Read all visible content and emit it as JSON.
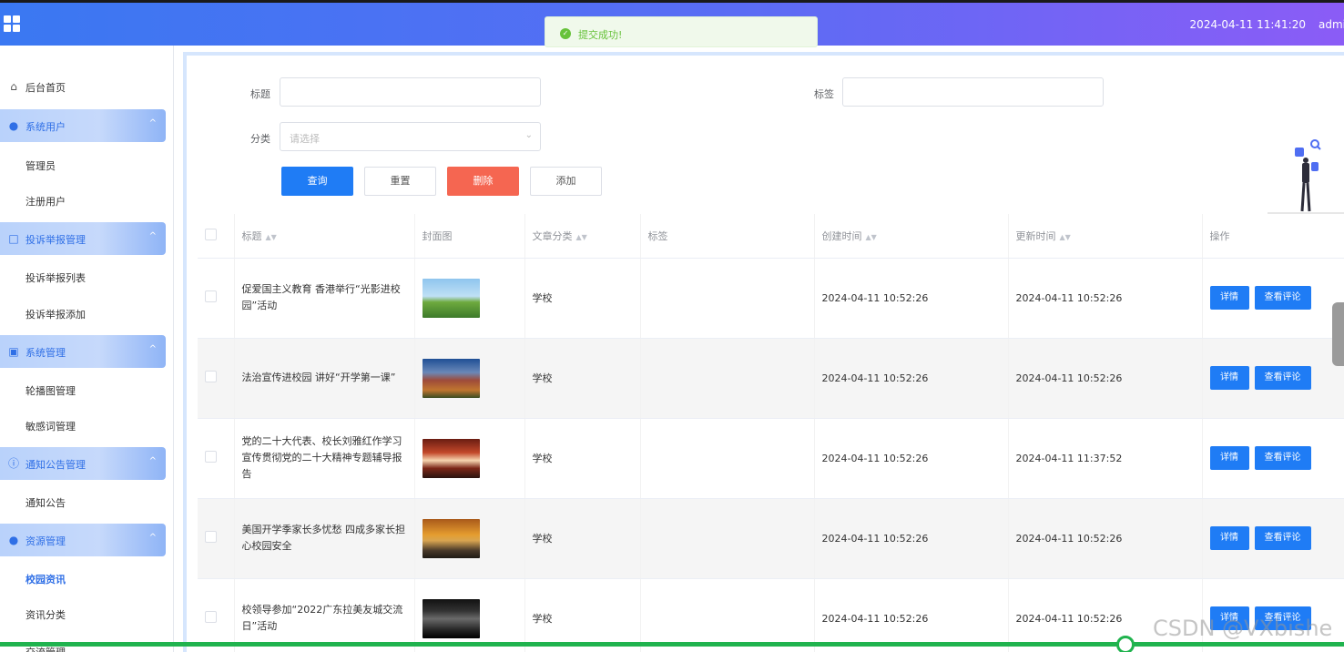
{
  "topbar": {
    "datetime": "2024-04-11 11:41:20",
    "user": "admi"
  },
  "toast": {
    "message": "提交成功!"
  },
  "sidebar": {
    "items": [
      {
        "label": "后台首页",
        "icon": "home-icon",
        "type": "item"
      },
      {
        "label": "系统用户",
        "icon": "user-icon",
        "type": "group"
      },
      {
        "label": "管理员",
        "type": "sub"
      },
      {
        "label": "注册用户",
        "type": "sub"
      },
      {
        "label": "投诉举报管理",
        "icon": "report-icon",
        "type": "group"
      },
      {
        "label": "投诉举报列表",
        "type": "sub"
      },
      {
        "label": "投诉举报添加",
        "type": "sub"
      },
      {
        "label": "系统管理",
        "icon": "picture-icon",
        "type": "group"
      },
      {
        "label": "轮播图管理",
        "type": "sub"
      },
      {
        "label": "敏感词管理",
        "type": "sub"
      },
      {
        "label": "通知公告管理",
        "icon": "info-icon",
        "type": "group"
      },
      {
        "label": "通知公告",
        "type": "sub"
      },
      {
        "label": "资源管理",
        "icon": "location-icon",
        "type": "group"
      },
      {
        "label": "校园资讯",
        "type": "sub",
        "active": true
      },
      {
        "label": "资讯分类",
        "type": "sub"
      },
      {
        "label": "交流管理",
        "type": "group-cut"
      }
    ]
  },
  "filters": {
    "title_label": "标题",
    "tag_label": "标签",
    "category_label": "分类",
    "category_placeholder": "请选择",
    "title_value": "",
    "tag_value": ""
  },
  "actions": {
    "search": "查询",
    "reset": "重置",
    "delete": "删除",
    "add": "添加"
  },
  "table": {
    "headers": [
      "标题",
      "封面图",
      "文章分类",
      "标签",
      "创建时间",
      "更新时间",
      "操作"
    ],
    "rows": [
      {
        "title": "促爱国主义教育 香港举行“光影进校园”活动",
        "category": "学校",
        "tag": "",
        "created": "2024-04-11 10:52:26",
        "updated": "2024-04-11 10:52:26"
      },
      {
        "title": "法治宣传进校园 讲好“开学第一课”",
        "category": "学校",
        "tag": "",
        "created": "2024-04-11 10:52:26",
        "updated": "2024-04-11 10:52:26"
      },
      {
        "title": "党的二十大代表、校长刘雅红作学习宣传贯彻党的二十大精神专题辅导报告",
        "category": "学校",
        "tag": "",
        "created": "2024-04-11 10:52:26",
        "updated": "2024-04-11 11:37:52"
      },
      {
        "title": "美国开学季家长多忧愁 四成多家长担心校园安全",
        "category": "学校",
        "tag": "",
        "created": "2024-04-11 10:52:26",
        "updated": "2024-04-11 10:52:26"
      },
      {
        "title": "校领导参加“2022广东拉美友城交流日”活动",
        "category": "学校",
        "tag": "",
        "created": "2024-04-11 10:52:26",
        "updated": "2024-04-11 10:52:26"
      }
    ],
    "detail_label": "详情",
    "comments_label": "查看评论"
  },
  "watermark": "CSDN @VXbishe",
  "colors": {
    "primary": "#1f7cf5",
    "danger": "#f56651",
    "success": "#67c23a"
  }
}
